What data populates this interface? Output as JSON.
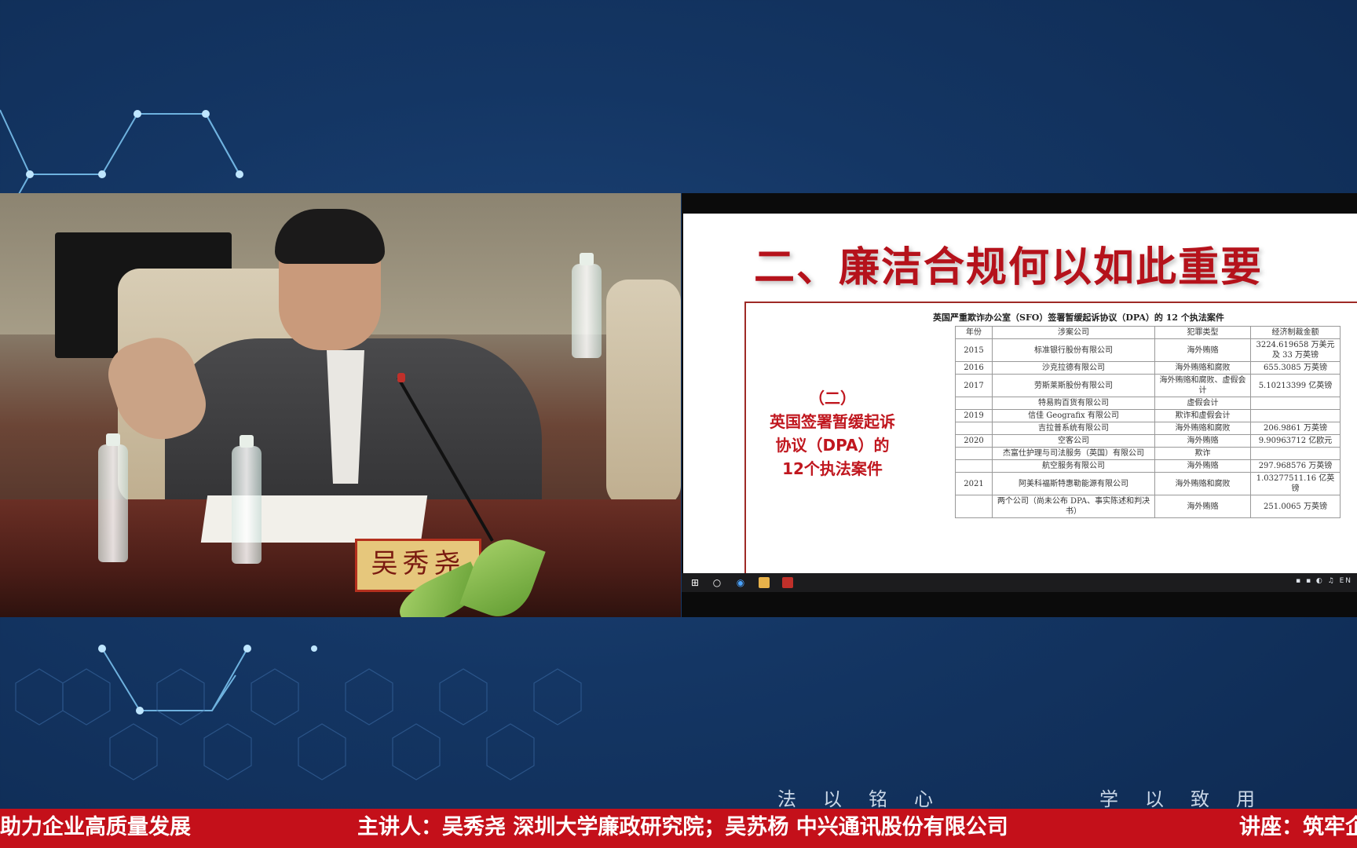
{
  "slide": {
    "title": "二、廉洁合规何以如此重要",
    "subtitle_lines": [
      "（二）",
      "英国签署暂缓起诉",
      "协议（DPA）的",
      "12个执法案件"
    ],
    "table_caption": "英国严重欺诈办公室（SFO）签署暂缓起诉协议（DPA）的 12 个执法案件",
    "table_headers": [
      "年份",
      "涉案公司",
      "犯罪类型",
      "经济制裁金额"
    ],
    "rows": [
      {
        "year": "2015",
        "company": "标准银行股份有限公司",
        "type": "海外贿赂",
        "amount": "3224.619658 万美元及 33 万英镑"
      },
      {
        "year": "2016",
        "company": "沙克拉德有限公司",
        "type": "海外贿赂和腐败",
        "amount": "655.3085 万英镑"
      },
      {
        "year": "2017",
        "company": "劳斯莱斯股份有限公司",
        "type": "海外贿赂和腐败、虚假会计",
        "amount": "5.10213399 亿英镑"
      },
      {
        "year": "",
        "company": "特易购百货有限公司",
        "type": "虚假会计",
        "amount": ""
      },
      {
        "year": "2019",
        "company": "信佳 Geografix 有限公司",
        "type": "欺诈和虚假会计",
        "amount": ""
      },
      {
        "year": "",
        "company": "吉拉普系统有限公司",
        "type": "海外贿赂和腐败",
        "amount": "206.9861 万英镑"
      },
      {
        "year": "2020",
        "company": "空客公司",
        "type": "海外贿赂",
        "amount": "9.90963712 亿欧元"
      },
      {
        "year": "",
        "company": "杰富仕护理与司法服务（英国）有限公司",
        "type": "欺诈",
        "amount": ""
      },
      {
        "year": "",
        "company": "航空服务有限公司",
        "type": "海外贿赂",
        "amount": "297.968576 万英镑"
      },
      {
        "year": "2021",
        "company": "阿美科福斯特惠勒能源有限公司",
        "type": "海外贿赂和腐败",
        "amount": "1.03277511.16 亿英镑"
      },
      {
        "year": "",
        "company": "两个公司（尚未公布 DPA、事实陈述和判决书）",
        "type": "海外贿赂",
        "amount": "251.0065 万英镑"
      }
    ]
  },
  "video": {
    "nameplate": "吴秀尧"
  },
  "taskbar": {
    "icons": [
      "windows-start-icon",
      "search-circle-icon",
      "browser-icon",
      "media-player-icon",
      "presentation-app-icon"
    ],
    "tray_text": "EN"
  },
  "motto": {
    "left": "法以铭心",
    "right": "学以致用"
  },
  "banner": {
    "left": "助力企业高质量发展",
    "center": "主讲人：吴秀尧  深圳大学廉政研究院；吴苏杨  中兴通讯股份有限公司",
    "right": "讲座：筑牢企"
  },
  "colors": {
    "background": "#143664",
    "banner": "#c4101a",
    "slide_title": "#b5121b",
    "network_line": "#8fd3ff"
  }
}
